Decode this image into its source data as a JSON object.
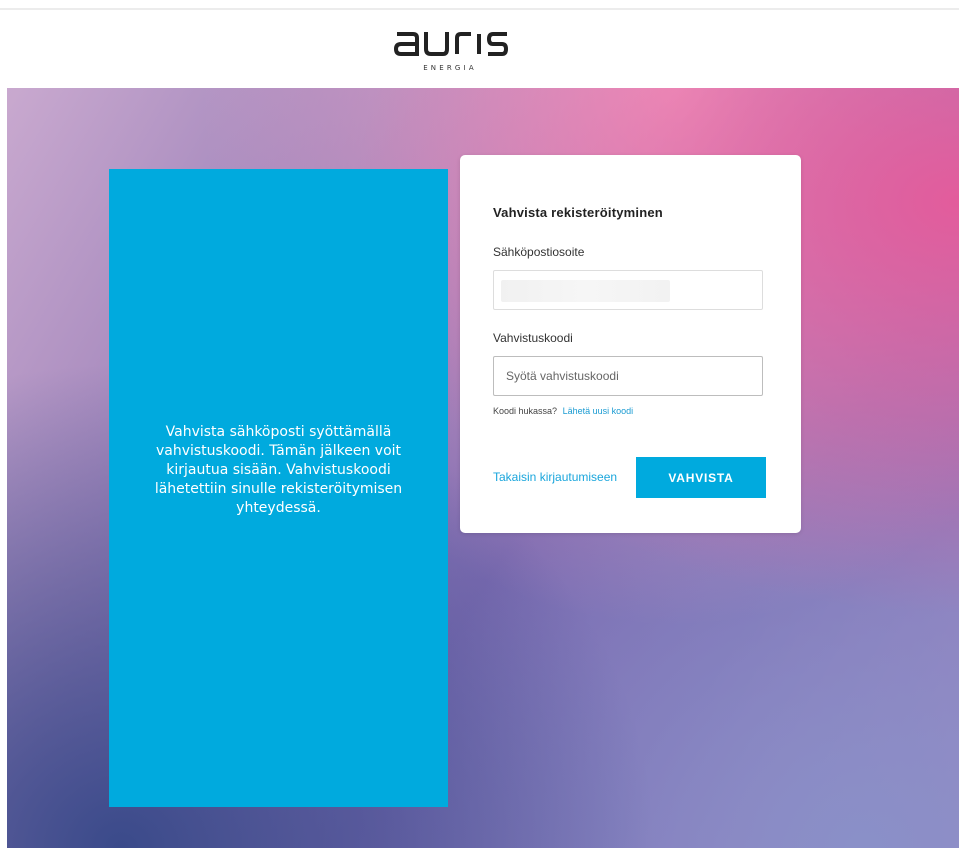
{
  "header": {
    "logo_text": "auris",
    "logo_subtitle": "ENERGIA"
  },
  "info_panel": {
    "text": "Vahvista sähköposti syöttämällä vahvistuskoodi. Tämän jälkeen voit kirjautua sisään. Vahvistuskoodi lähetettiin sinulle rekisteröitymisen yhteydessä."
  },
  "form": {
    "title": "Vahvista rekisteröityminen",
    "email_label": "Sähköpostiosoite",
    "email_value": "",
    "code_label": "Vahvistuskoodi",
    "code_placeholder": "Syötä vahvistuskoodi",
    "lost_code_text": "Koodi hukassa?",
    "resend_link": "Lähetä uusi koodi",
    "back_link": "Takaisin kirjautumiseen",
    "confirm_button": "VAHVISTA"
  },
  "colors": {
    "accent": "#00aade",
    "link": "#1aa6dc"
  }
}
